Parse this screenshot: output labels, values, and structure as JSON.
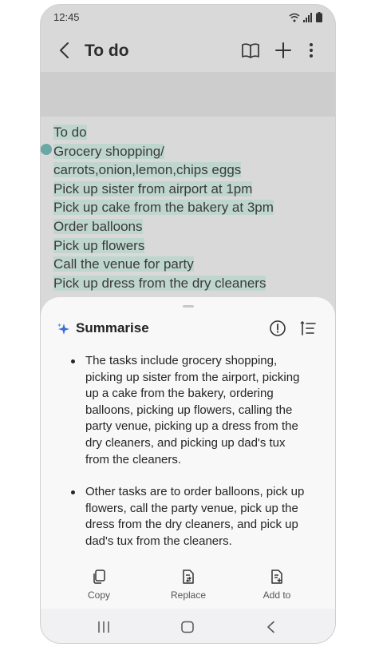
{
  "status_bar": {
    "time": "12:45",
    "icons": [
      "wifi-icon",
      "signal-icon",
      "battery-icon"
    ]
  },
  "app_bar": {
    "title": "To do",
    "icons": [
      "back-icon",
      "book-icon",
      "add-icon",
      "more-icon"
    ]
  },
  "note": {
    "lines": [
      "To do",
      "Grocery shopping/",
      "carrots,onion,lemon,chips eggs",
      "Pick up sister from airport at 1pm",
      "Pick up cake from the bakery at 3pm",
      "Order balloons",
      "Pick up flowers",
      "Call the venue for party",
      "Pick up dress from the dry cleaners"
    ]
  },
  "sheet": {
    "title": "Summarise",
    "header_icons": [
      "info-icon",
      "list-settings-icon"
    ],
    "bullets": [
      "The tasks include grocery shopping, picking up sister from the airport, picking up a cake from the bakery, ordering balloons, picking up flowers, calling the party venue, picking up a dress from the dry cleaners, and picking up dad's tux from the cleaners.",
      "Other tasks are to order balloons, pick up flowers, call the party venue, pick up the dress from the dry cleaners, and pick up dad's tux from the cleaners."
    ],
    "actions": {
      "copy": "Copy",
      "replace": "Replace",
      "add_to": "Add to"
    }
  },
  "nav_bar": {
    "icons": [
      "recents-icon",
      "home-icon",
      "back-nav-icon"
    ]
  },
  "colors": {
    "highlight_green": "#bfd6cf",
    "highlight_blue": "#aebfd8",
    "accent": "#3b6fd8"
  }
}
